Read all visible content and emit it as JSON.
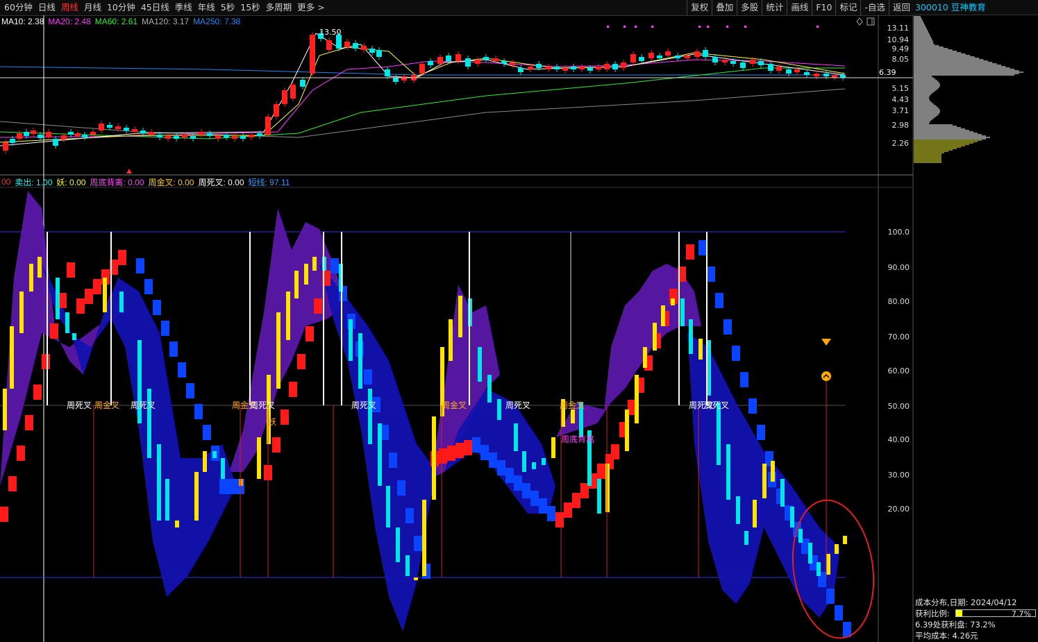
{
  "toolbar": {
    "left_items": [
      {
        "label": "60分钟",
        "active": false
      },
      {
        "label": "日线",
        "active": false
      },
      {
        "label": "周线",
        "active": true
      },
      {
        "label": "月线",
        "active": false
      },
      {
        "label": "10分钟",
        "active": false
      },
      {
        "label": "45日线",
        "active": false
      },
      {
        "label": "季线",
        "active": false
      },
      {
        "label": "年线",
        "active": false
      },
      {
        "label": "5秒",
        "active": false
      },
      {
        "label": "15秒",
        "active": false
      },
      {
        "label": "多周期",
        "active": false
      },
      {
        "label": "更多 >",
        "active": false
      }
    ],
    "right_items": [
      "复权",
      "叠加",
      "多股",
      "统计",
      "画线",
      "F10",
      "标记",
      "-自选",
      "返回"
    ]
  },
  "stock": {
    "title": "300010 豆神教育"
  },
  "ma_legend": [
    {
      "label": "MA10: 2.38",
      "color": "#ffffff"
    },
    {
      "label": "MA20: 2.48",
      "color": "#ff3cff"
    },
    {
      "label": "MA60: 2.61",
      "color": "#33ee33"
    },
    {
      "label": "MA120: 3.17",
      "color": "#b0b0b0"
    },
    {
      "label": "MA250: 7.38",
      "color": "#2288ee"
    }
  ],
  "indicator_legend": [
    {
      "label": "00",
      "color": "#ff3030"
    },
    {
      "label": "卖出: 1.00",
      "color": "#00ffff"
    },
    {
      "label": "妖: 0.00",
      "color": "#ffff00"
    },
    {
      "label": "周底背离: 0.00",
      "color": "#ff44ff"
    },
    {
      "label": "周金叉: 0.00",
      "color": "#ffcc00"
    },
    {
      "label": "周死叉: 0.00",
      "color": "#ffffff"
    },
    {
      "label": "短线: 97.11",
      "color": "#3399ff"
    }
  ],
  "price_axis": [
    "13.11",
    "10.94",
    "9.49",
    "8.05",
    "6.39",
    "5.15",
    "4.43",
    "3.71",
    "2.98",
    "2.26"
  ],
  "current_price": "6.39",
  "peak_label": "13.50",
  "indicator_axis": [
    "100.0",
    "90.00",
    "80.00",
    "70.00",
    "60.00",
    "50.00",
    "40.00",
    "30.00",
    "20.00"
  ],
  "signal_labels": [
    {
      "text": "周死叉",
      "type": "dead"
    },
    {
      "text": "周金叉",
      "type": "gold"
    },
    {
      "text": "周死叉",
      "type": "dead"
    },
    {
      "text": "周金叉",
      "type": "gold"
    },
    {
      "text": "周死叉",
      "type": "dead"
    },
    {
      "text": "妖",
      "type": "yao"
    },
    {
      "text": "周死叉",
      "type": "dead"
    },
    {
      "text": "周金叉",
      "type": "gold"
    },
    {
      "text": "周死叉",
      "type": "dead"
    },
    {
      "text": "周金叉",
      "type": "gold"
    },
    {
      "text": "周底背离",
      "type": "div"
    },
    {
      "text": "周死叉",
      "type": "dead"
    }
  ],
  "cost_panel": {
    "title": "成本分布,日期:  2024/04/12",
    "profit_ratio_label": "获利比例:",
    "profit_ratio_value": "7.7%",
    "profit_ratio_fraction": 0.077,
    "profit_at_price": "6.39处获利盘: 73.2%",
    "avg_cost": "平均成本: 4.26元"
  },
  "colors": {
    "up": "#ff2020",
    "down": "#00e5e5",
    "background": "#000000",
    "band_purple": "#5a18a8",
    "band_blue": "#1212b0",
    "annotation_circle": "#e02020"
  }
}
